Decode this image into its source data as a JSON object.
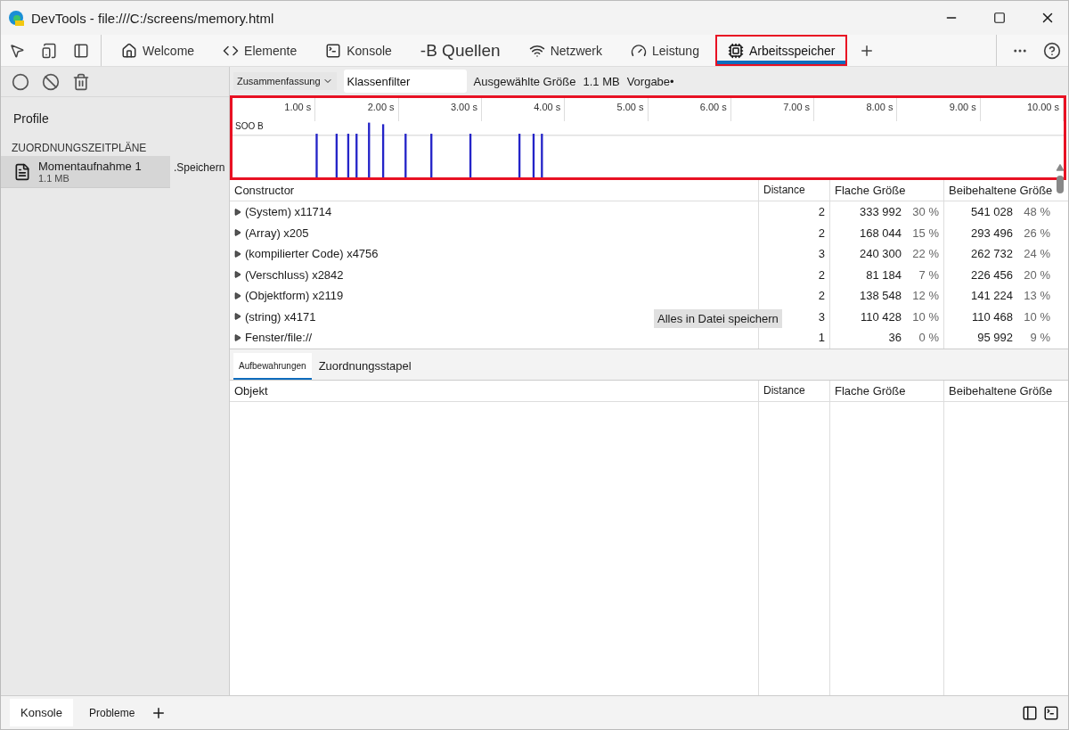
{
  "window": {
    "title": "DevTools - file:///C:/screens/memory.html"
  },
  "toolbar_tabs": [
    {
      "label": "Welcome",
      "kind": "home",
      "selected": false,
      "highlighted": false
    },
    {
      "label": "Elemente",
      "kind": "code",
      "selected": false,
      "highlighted": false
    },
    {
      "label": "Konsole",
      "kind": "console",
      "selected": false,
      "highlighted": false
    },
    {
      "label": "-B Quellen",
      "kind": "text",
      "selected": false,
      "highlighted": false
    },
    {
      "label": "Netzwerk",
      "kind": "wifi",
      "selected": false,
      "highlighted": false
    },
    {
      "label": "Leistung",
      "kind": "gauge",
      "selected": false,
      "highlighted": false
    },
    {
      "label": "Arbeitsspeicher",
      "kind": "chip",
      "selected": true,
      "highlighted": true
    }
  ],
  "sidebar": {
    "profiles_label": "Profile",
    "section": "ZUORDNUNGSZEITPLÄNE",
    "items": [
      {
        "name": "Momentaufnahme 1",
        "size": "1.1 MB",
        "selected": true
      }
    ],
    "save_label": ".Speichern"
  },
  "filter_bar": {
    "view": "Zusammenfassung",
    "class_filter": {
      "placeholder": "Klassenfilter"
    },
    "selected_size": "Ausgewählte Größe",
    "size_value": "1.1 MB",
    "default": "Vorgabe•"
  },
  "timeline": {
    "highlighted": true,
    "ticks": [
      "1.00 s",
      "2.00 s",
      "3.00 s",
      "4.00 s",
      "5.00 s",
      "6.00 s",
      "7.00 s",
      "8.00 s",
      "9.00 s",
      "10.00 s"
    ],
    "scale_label": "SOO B"
  },
  "table": {
    "columns": [
      "Constructor",
      "Distance",
      "Flache Größe",
      "Beibehaltene Größe"
    ],
    "rows": [
      {
        "name": "(System) x11714",
        "distance": "2",
        "shallow": "333 992",
        "shallow_pct": "30 %",
        "retained": "541 028",
        "retained_pct": "48 %"
      },
      {
        "name": "(Array) x205",
        "distance": "2",
        "shallow": "168 044",
        "shallow_pct": "15 %",
        "retained": "293 496",
        "retained_pct": "26 %"
      },
      {
        "name": "(kompilierter Code) x4756",
        "distance": "3",
        "shallow": "240 300",
        "shallow_pct": "22 %",
        "retained": "262 732",
        "retained_pct": "24 %"
      },
      {
        "name": "(Verschluss) x2842",
        "distance": "2",
        "shallow": "81 184",
        "shallow_pct": "7 %",
        "retained": "226 456",
        "retained_pct": "20 %"
      },
      {
        "name": "(Objektform) x2119",
        "distance": "2",
        "shallow": "138 548",
        "shallow_pct": "12 %",
        "retained": "141 224",
        "retained_pct": "13 %"
      },
      {
        "name": "(string) x4171",
        "distance": "3",
        "shallow": "110 428",
        "shallow_pct": "10 %",
        "retained": "110 468",
        "retained_pct": "10 %"
      },
      {
        "name": "Fenster/file://",
        "distance": "1",
        "shallow": "36",
        "shallow_pct": "0 %",
        "retained": "95 992",
        "retained_pct": "9 %"
      }
    ],
    "tooltip": "Alles in Datei speichern"
  },
  "lower_tabs": [
    {
      "label": "Aufbewahrungen",
      "selected": true
    },
    {
      "label": "Zuordnungsstapel",
      "selected": false
    }
  ],
  "lower_table": {
    "columns": [
      "Objekt",
      "Distance",
      "Flache Größe",
      "Beibehaltene Größe"
    ]
  },
  "drawer_tabs": [
    {
      "label": "Konsole",
      "selected": true
    },
    {
      "label": "Probleme",
      "selected": false
    }
  ]
}
